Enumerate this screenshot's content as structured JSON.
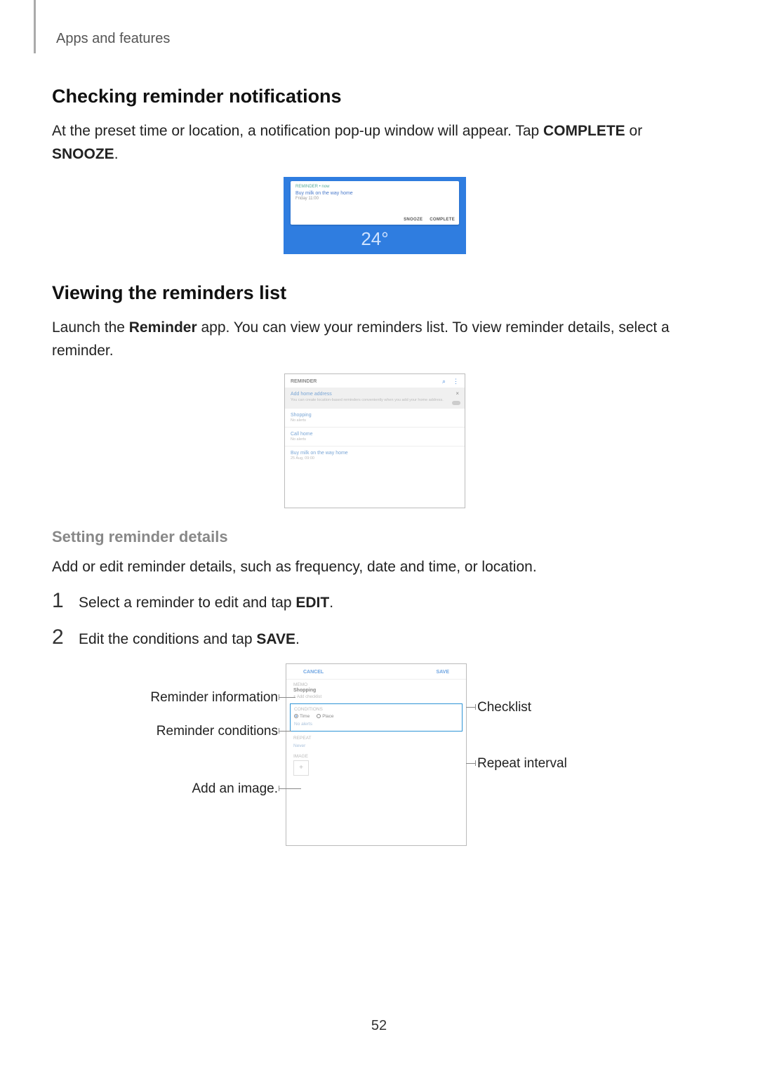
{
  "header": "Apps and features",
  "page_number": "52",
  "section1": {
    "heading": "Checking reminder notifications",
    "para_pre": "At the preset time or location, a notification pop-up window will appear. Tap ",
    "complete": "COMPLETE",
    "para_mid": " or ",
    "snooze": "SNOOZE",
    "para_post": "."
  },
  "fig1": {
    "app": "REMINDER • now",
    "title": "Buy milk on the way home",
    "sub": "Friday 11:00",
    "snooze": "SNOOZE",
    "complete": "COMPLETE",
    "clock": "24°"
  },
  "section2": {
    "heading": "Viewing the reminders list",
    "para_pre": "Launch the ",
    "appname": "Reminder",
    "para_post": " app. You can view your reminders list. To view reminder details, select a reminder."
  },
  "fig2": {
    "title": "REMINDER",
    "search_icon": "⌕",
    "more_icon": "⋮",
    "banner_title": "Add home address",
    "banner_sub": "You can create location-based reminders conveniently when you add your home address.",
    "items": [
      {
        "t": "Shopping",
        "s": "No alerts"
      },
      {
        "t": "Call home",
        "s": "No alerts"
      },
      {
        "t": "Buy milk on the way home",
        "s": "25 Aug, 09:00"
      }
    ]
  },
  "section3": {
    "heading": "Setting reminder details",
    "para": "Add or edit reminder details, such as frequency, date and time, or location.",
    "step1_pre": "Select a reminder to edit and tap ",
    "step1_bold": "EDIT",
    "step1_post": ".",
    "step2_pre": "Edit the conditions and tap ",
    "step2_bold": "SAVE",
    "step2_post": "."
  },
  "fig3": {
    "cancel": "CANCEL",
    "save": "SAVE",
    "memo_label": "MEMO",
    "memo_value": "Shopping",
    "checklist": "+ Add checklist",
    "cond_label": "CONDITIONS",
    "radio_time": "Time",
    "radio_place": "Place",
    "no_alerts": "No alerts",
    "repeat_label": "REPEAT",
    "repeat_value": "Never",
    "image_label": "IMAGE",
    "image_plus": "+"
  },
  "callouts": {
    "info": "Reminder information",
    "conditions": "Reminder conditions",
    "add_img": "Add an image.",
    "checklist": "Checklist",
    "repeat": "Repeat interval"
  }
}
